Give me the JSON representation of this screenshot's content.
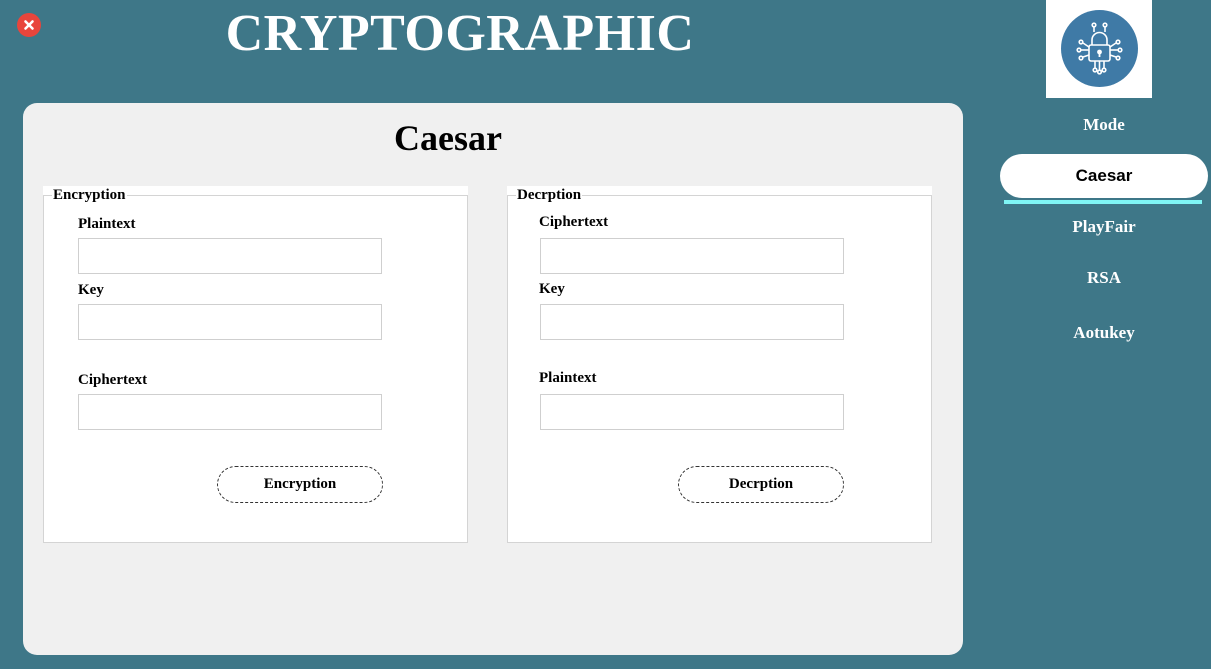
{
  "window": {
    "title": "CRYPTOGRAPHIC",
    "close_icon": "close-icon",
    "logo_icon": "lock-circuit-icon"
  },
  "colors": {
    "background": "#3e7788",
    "panel": "#f0f0f0",
    "close": "#e8453c",
    "logo": "#3f7aa6",
    "active_underline": "#7ff5f5"
  },
  "main": {
    "title": "Caesar",
    "encryption": {
      "caption": "Encryption",
      "plaintext_label": "Plaintext",
      "plaintext_value": "",
      "key_label": "Key",
      "key_value": "",
      "ciphertext_label": "Ciphertext",
      "ciphertext_value": "",
      "button_label": "Encryption"
    },
    "decryption": {
      "caption": "Decrption",
      "ciphertext_label": "Ciphertext",
      "ciphertext_value": "",
      "key_label": "Key",
      "key_value": "",
      "plaintext_label": "Plaintext",
      "plaintext_value": "",
      "button_label": "Decrption"
    }
  },
  "sidebar": {
    "items": [
      {
        "label": "Mode",
        "active": false
      },
      {
        "label": "Caesar",
        "active": true
      },
      {
        "label": "PlayFair",
        "active": false
      },
      {
        "label": "RSA",
        "active": false
      },
      {
        "label": "Aotukey",
        "active": false
      }
    ]
  }
}
